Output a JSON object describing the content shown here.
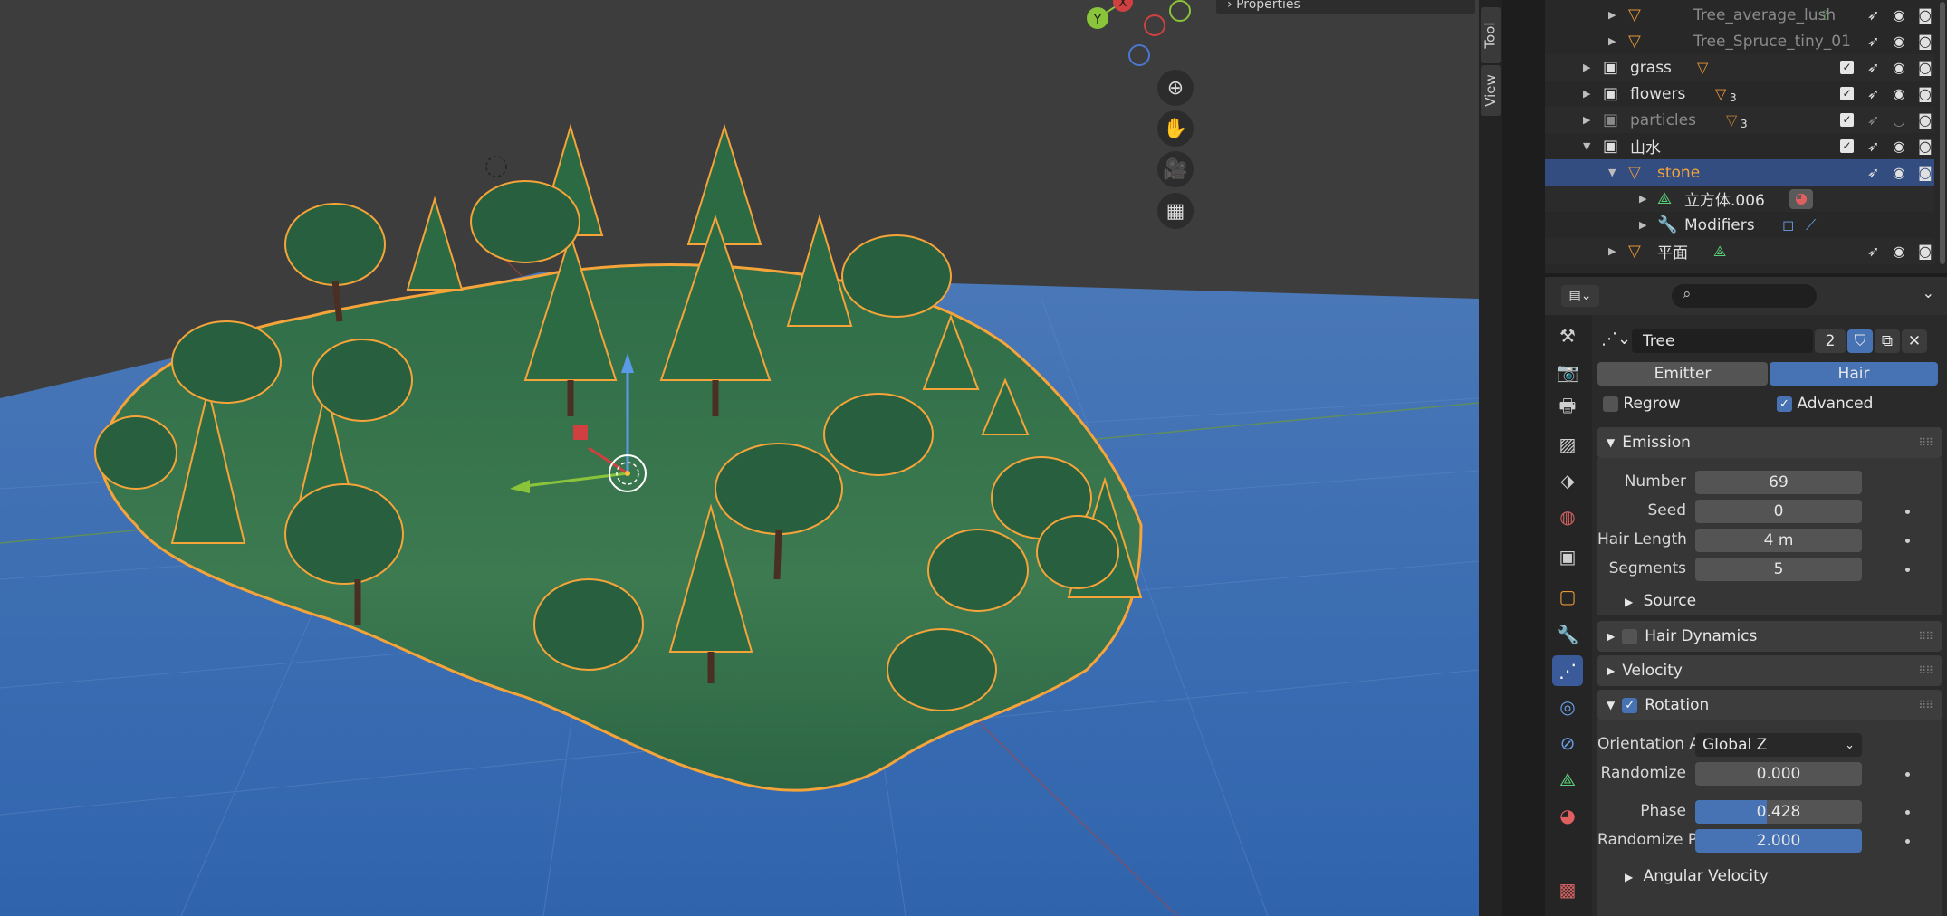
{
  "viewport": {
    "properties_tab_label": "Properties",
    "axis_labels": {
      "y": "Y",
      "x": "X"
    },
    "nav_buttons": [
      {
        "icon": "zoom-icon",
        "glyph": "⊕"
      },
      {
        "icon": "hand-pan-icon",
        "glyph": "✋"
      },
      {
        "icon": "camera-icon",
        "glyph": "🎥"
      },
      {
        "icon": "grid-perspective-icon",
        "glyph": "▦"
      }
    ]
  },
  "side_tabs": {
    "tool": "Tool",
    "view": "View"
  },
  "outliner": {
    "rows": [
      {
        "name": "Tree_average_lush",
        "type": "object",
        "dimmed": true
      },
      {
        "name": "Tree_Spruce_tiny_01",
        "type": "object",
        "dimmed": true
      },
      {
        "name": "grass",
        "type": "collection",
        "count": ""
      },
      {
        "name": "flowers",
        "type": "collection",
        "count": "3"
      },
      {
        "name": "particles",
        "type": "collection",
        "count": "3",
        "dimmed": true
      },
      {
        "name": "山水",
        "type": "collection"
      },
      {
        "name": "stone",
        "type": "object",
        "selected": true
      },
      {
        "name": "立方体.006",
        "type": "mesh-data"
      },
      {
        "name": "Modifiers",
        "type": "modifiers"
      },
      {
        "name": "平面",
        "type": "object"
      }
    ]
  },
  "properties": {
    "search_placeholder": "",
    "particle_system": {
      "name": "Tree",
      "users": "2"
    },
    "type_tabs": {
      "emitter": "Emitter",
      "hair": "Hair",
      "active": "hair"
    },
    "regrow_label": "Regrow",
    "advanced_label": "Advanced",
    "emission": {
      "title": "Emission",
      "number_label": "Number",
      "number_value": "69",
      "seed_label": "Seed",
      "seed_value": "0",
      "hair_length_label": "Hair Length",
      "hair_length_value": "4 m",
      "segments_label": "Segments",
      "segments_value": "5",
      "source_label": "Source"
    },
    "hair_dynamics_label": "Hair Dynamics",
    "velocity_label": "Velocity",
    "rotation": {
      "title": "Rotation",
      "orientation_label": "Orientation A...",
      "orientation_value": "Global Z",
      "randomize_label": "Randomize",
      "randomize_value": "0.000",
      "phase_label": "Phase",
      "phase_value": "0.428",
      "phase_fraction": 0.428,
      "randomize_phase_label": "Randomize P...",
      "randomize_phase_value": "2.000"
    },
    "angular_velocity_label": "Angular Velocity"
  }
}
